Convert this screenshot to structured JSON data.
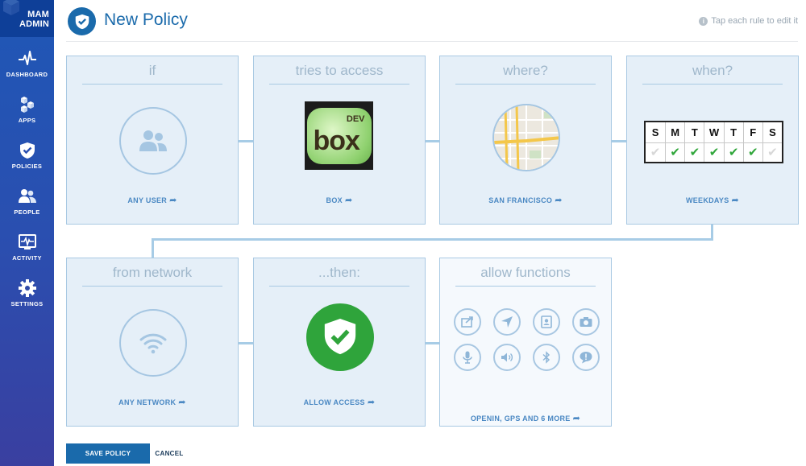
{
  "brand": {
    "line1": "MAM",
    "line2": "ADMIN"
  },
  "sidebar": {
    "items": [
      {
        "label": "DASHBOARD",
        "icon": "pulse-icon"
      },
      {
        "label": "APPS",
        "icon": "cubes-icon"
      },
      {
        "label": "POLICIES",
        "icon": "shield-check-icon"
      },
      {
        "label": "PEOPLE",
        "icon": "people-icon"
      },
      {
        "label": "ACTIVITY",
        "icon": "activity-monitor-icon"
      },
      {
        "label": "SETTINGS",
        "icon": "gear-icon"
      }
    ]
  },
  "header": {
    "title": "New Policy",
    "hint": "Tap each rule to edit it"
  },
  "cards": {
    "if": {
      "title": "if",
      "label": "ANY USER"
    },
    "access": {
      "title": "tries to access",
      "label": "BOX",
      "logo_word": "box",
      "logo_tag": "DEV"
    },
    "where": {
      "title": "where?",
      "label": "SAN FRANCISCO"
    },
    "when": {
      "title": "when?",
      "label": "WEEKDAYS",
      "days": [
        "S",
        "M",
        "T",
        "W",
        "T",
        "F",
        "S"
      ],
      "active": [
        false,
        true,
        true,
        true,
        true,
        true,
        false
      ]
    },
    "network": {
      "title": "from network",
      "label": "ANY NETWORK"
    },
    "then": {
      "title": "...then:",
      "label": "ALLOW ACCESS"
    },
    "functions": {
      "title": "allow functions",
      "label": "OPENIN, GPS AND 6 MORE",
      "items": [
        "open-in-icon",
        "gps-icon",
        "contacts-icon",
        "camera-icon",
        "microphone-icon",
        "speaker-icon",
        "bluetooth-icon",
        "chat-icon"
      ]
    }
  },
  "footer": {
    "save": "SAVE POLICY",
    "cancel": "CANCEL"
  },
  "colors": {
    "accent": "#1a6aab",
    "sidebar": "#2a4fb0",
    "card": "#e5eff8",
    "check": "#2fa63a"
  }
}
